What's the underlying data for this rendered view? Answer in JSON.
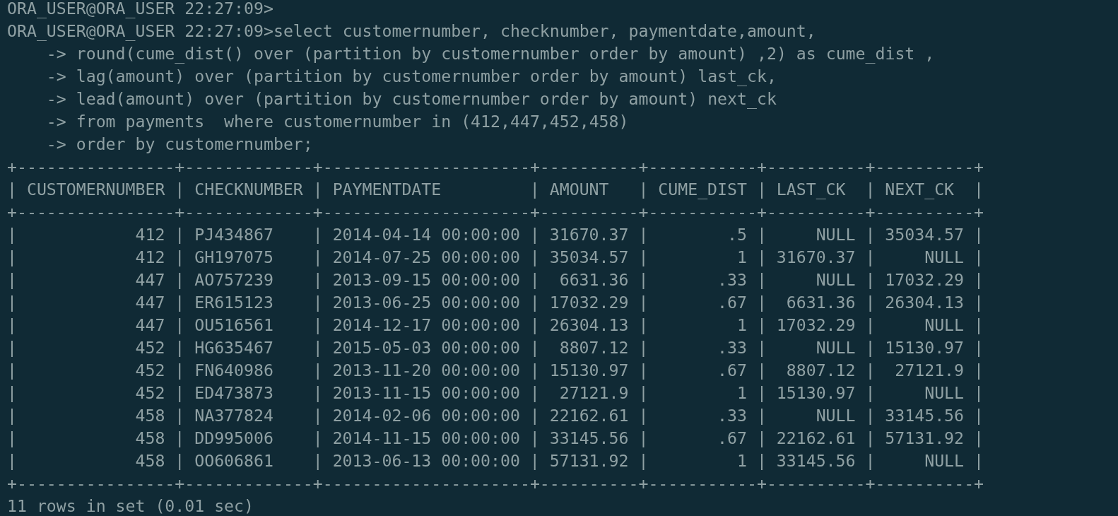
{
  "session": [
    {
      "kind": "prompt",
      "prompt": "ORA_USER@ORA_USER 22:27:09>"
    },
    {
      "kind": "prompt",
      "prompt": "ORA_USER@ORA_USER 22:27:09>",
      "command": "select customernumber, checknumber, paymentdate,amount,"
    },
    {
      "kind": "continuation",
      "command": "    -> round(cume_dist() over (partition by customernumber order by amount) ,2) as cume_dist ,"
    },
    {
      "kind": "continuation",
      "command": "    -> lag(amount) over (partition by customernumber order by amount) last_ck,"
    },
    {
      "kind": "continuation",
      "command": "    -> lead(amount) over (partition by customernumber order by amount) next_ck"
    },
    {
      "kind": "continuation",
      "command": "    -> from payments  where customernumber in (412,447,452,458)"
    },
    {
      "kind": "continuation",
      "command": "    -> order by customernumber;"
    }
  ],
  "table": {
    "border": "+----------------+-------------+---------------------+----------+-----------+----------+----------+",
    "separator": "|",
    "columns": [
      {
        "label": "CUSTOMERNUMBER",
        "kind": "number"
      },
      {
        "label": "CHECKNUMBER",
        "kind": "text"
      },
      {
        "label": "PAYMENTDATE",
        "kind": "text"
      },
      {
        "label": "AMOUNT",
        "kind": "number"
      },
      {
        "label": "CUME_DIST",
        "kind": "number"
      },
      {
        "label": "LAST_CK",
        "kind": "number"
      },
      {
        "label": "NEXT_CK",
        "kind": "number"
      }
    ],
    "rows": [
      [
        "412",
        "PJ434867",
        "2014-04-14 00:00:00",
        "31670.37",
        ".5",
        "NULL",
        "35034.57"
      ],
      [
        "412",
        "GH197075",
        "2014-07-25 00:00:00",
        "35034.57",
        "1",
        "31670.37",
        "NULL"
      ],
      [
        "447",
        "AO757239",
        "2013-09-15 00:00:00",
        "6631.36",
        ".33",
        "NULL",
        "17032.29"
      ],
      [
        "447",
        "ER615123",
        "2013-06-25 00:00:00",
        "17032.29",
        ".67",
        "6631.36",
        "26304.13"
      ],
      [
        "447",
        "OU516561",
        "2014-12-17 00:00:00",
        "26304.13",
        "1",
        "17032.29",
        "NULL"
      ],
      [
        "452",
        "HG635467",
        "2015-05-03 00:00:00",
        "8807.12",
        ".33",
        "NULL",
        "15130.97"
      ],
      [
        "452",
        "FN640986",
        "2013-11-20 00:00:00",
        "15130.97",
        ".67",
        "8807.12",
        "27121.9"
      ],
      [
        "452",
        "ED473873",
        "2013-11-15 00:00:00",
        "27121.9",
        "1",
        "15130.97",
        "NULL"
      ],
      [
        "458",
        "NA377824",
        "2014-02-06 00:00:00",
        "22162.61",
        ".33",
        "NULL",
        "33145.56"
      ],
      [
        "458",
        "DD995006",
        "2014-11-15 00:00:00",
        "33145.56",
        ".67",
        "22162.61",
        "57131.92"
      ],
      [
        "458",
        "OO606861",
        "2013-06-13 00:00:00",
        "57131.92",
        "1",
        "33145.56",
        "NULL"
      ]
    ]
  },
  "status": "11 rows in set (0.01 sec)"
}
